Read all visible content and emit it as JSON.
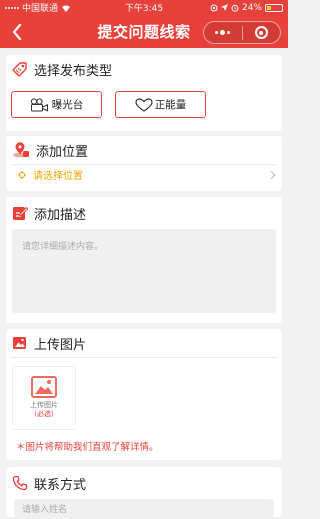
{
  "status_bar": {
    "carrier": "中国联通",
    "time": "下午3:45",
    "battery": "24%",
    "battery_level": 0.24
  },
  "navbar": {
    "title": "提交问题线索",
    "back_icon": "back-chevron-icon",
    "more_icon": "more-dots-icon",
    "close_icon": "capsule-close-icon"
  },
  "sections": {
    "type": {
      "title": "选择发布类型",
      "options": [
        {
          "label": "曝光台",
          "icon": "camera-icon"
        },
        {
          "label": "正能量",
          "icon": "heart-icon"
        }
      ]
    },
    "location": {
      "title": "添加位置",
      "placeholder": "请选择位置"
    },
    "description": {
      "title": "添加描述",
      "placeholder": "请您详细描述内容。"
    },
    "images": {
      "title": "上传图片",
      "upload_label": "上传图片",
      "upload_required": "(必选)",
      "hint": "＊图片将帮助我们直观了解详情。"
    },
    "contact": {
      "title": "联系方式",
      "name_placeholder": "请输入姓名"
    }
  },
  "colors": {
    "accent": "#e8403a",
    "location_text": "#f0a400",
    "background": "#f2f2f2"
  }
}
